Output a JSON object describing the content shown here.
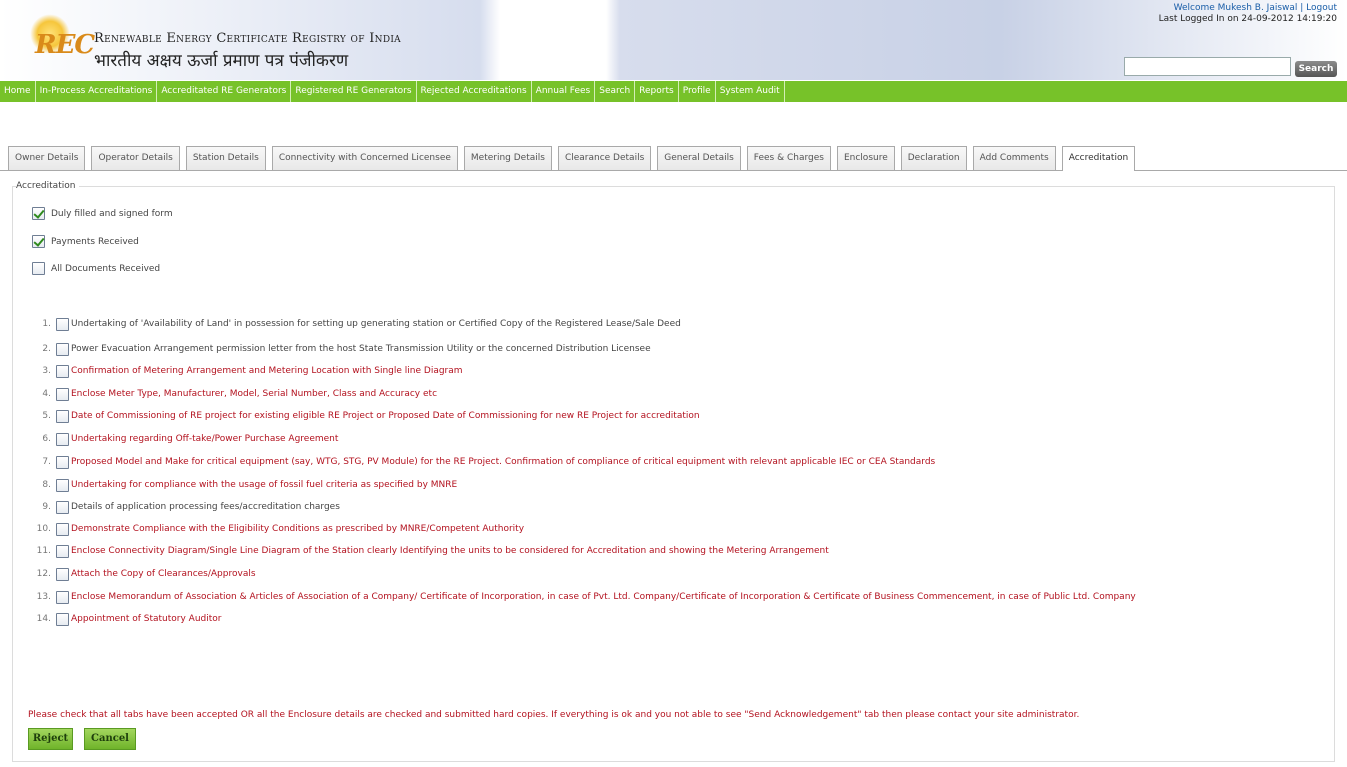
{
  "header": {
    "brand_logo": "REC",
    "brand_en": "Renewable Energy Certificate Registry of India",
    "brand_hi": "भारतीय अक्षय ऊर्जा प्रमाण पत्र पंजीकरण",
    "welcome": "Welcome Mukesh B. Jaiswal | Logout",
    "last_login": "Last Logged In on 24-09-2012 14:19:20",
    "search_placeholder": "",
    "search_button": "Search"
  },
  "nav": [
    "Home",
    "In-Process Accreditations",
    "Accreditated RE Generators",
    "Registered RE Generators",
    "Rejected Accreditations",
    "Annual Fees",
    "Search",
    "Reports",
    "Profile",
    "System Audit"
  ],
  "tabs": [
    "Owner Details",
    "Operator Details",
    "Station Details",
    "Connectivity with Concerned Licensee",
    "Metering Details",
    "Clearance Details",
    "General Details",
    "Fees & Charges",
    "Enclosure",
    "Declaration",
    "Add Comments",
    "Accreditation"
  ],
  "active_tab": "Accreditation",
  "accreditation": {
    "legend": "Accreditation",
    "checks": [
      {
        "label": "Duly filled and signed form",
        "checked": true
      },
      {
        "label": "Payments Received",
        "checked": true
      },
      {
        "label": "All Documents Received",
        "checked": false
      }
    ],
    "documents": [
      {
        "num": "1.",
        "text": "Undertaking of 'Availability of Land' in possession for setting up generating station or Certified Copy of the Registered Lease/Sale Deed",
        "color": "gray"
      },
      {
        "num": "2.",
        "text": "Power Evacuation Arrangement permission letter from the host State Transmission Utility or the concerned Distribution Licensee",
        "color": "gray"
      },
      {
        "num": "3.",
        "text": "Confirmation of Metering Arrangement and Metering Location with Single line Diagram",
        "color": "red"
      },
      {
        "num": "4.",
        "text": "Enclose Meter Type, Manufacturer, Model, Serial Number, Class and Accuracy etc",
        "color": "red"
      },
      {
        "num": "5.",
        "text": "Date of Commissioning of RE project for existing eligible RE Project or Proposed Date of Commissioning for new RE Project for accreditation",
        "color": "red"
      },
      {
        "num": "6.",
        "text": "Undertaking regarding Off-take/Power Purchase Agreement",
        "color": "red"
      },
      {
        "num": "7.",
        "text": "Proposed Model and Make for critical equipment (say, WTG, STG, PV Module) for the RE Project. Confirmation of compliance of critical equipment with relevant applicable IEC or CEA Standards",
        "color": "red"
      },
      {
        "num": "8.",
        "text": "Undertaking for compliance with the usage of fossil fuel criteria as specified by MNRE",
        "color": "red"
      },
      {
        "num": "9.",
        "text": "Details of application processing fees/accreditation charges",
        "color": "gray"
      },
      {
        "num": "10.",
        "text": "Demonstrate Compliance with the Eligibility Conditions as prescribed by MNRE/Competent Authority",
        "color": "red"
      },
      {
        "num": "11.",
        "text": "Enclose Connectivity Diagram/Single Line Diagram of the Station clearly Identifying the units to be considered for Accreditation and showing the Metering Arrangement",
        "color": "red"
      },
      {
        "num": "12.",
        "text": "Attach the Copy of Clearances/Approvals",
        "color": "red"
      },
      {
        "num": "13.",
        "text": "Enclose Memorandum of Association & Articles of Association of a Company/ Certificate of Incorporation, in case of Pvt. Ltd. Company/Certificate of Incorporation & Certificate of Business Commencement, in case of Public Ltd. Company",
        "color": "red"
      },
      {
        "num": "14.",
        "text": "Appointment of Statutory Auditor",
        "color": "red"
      }
    ],
    "note": "Please check that all tabs have been accepted OR all the Enclosure details are checked and submitted hard copies. If everything is ok and you not able to see \"Send Acknowledgement\" tab then please contact your site administrator.",
    "reject_label": "Reject",
    "cancel_label": "Cancel"
  }
}
